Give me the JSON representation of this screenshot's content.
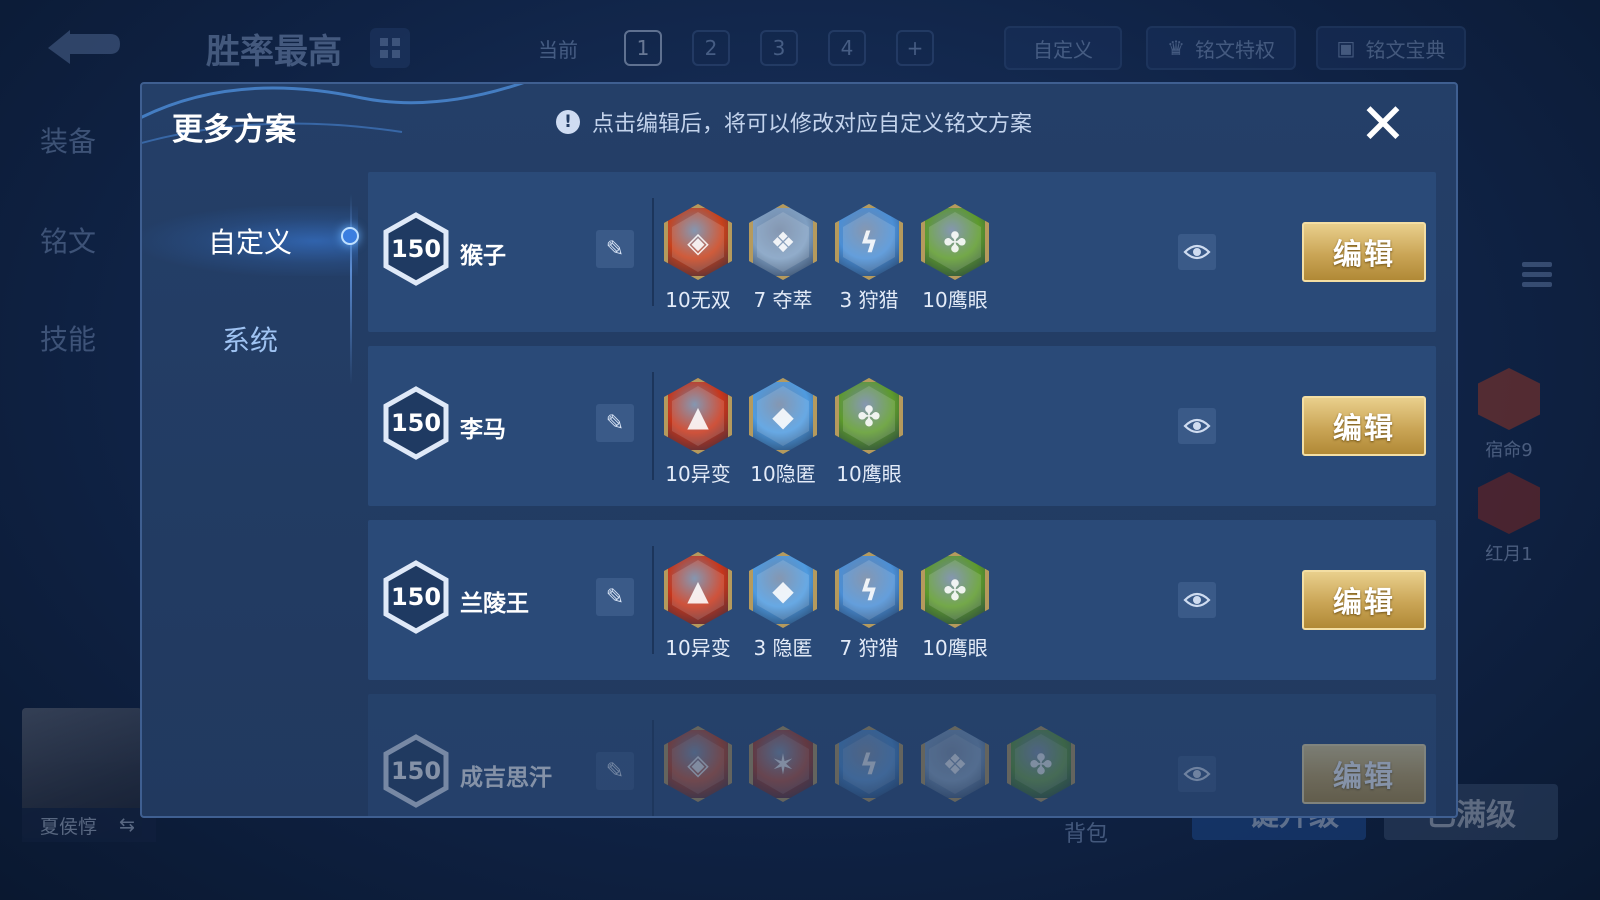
{
  "background": {
    "page_title": "胜率最高",
    "pages": {
      "current_label": "当前",
      "items": [
        "1",
        "2",
        "3",
        "4"
      ],
      "active": "1",
      "add": "+"
    },
    "custom_label": "自定义",
    "privilege_label": "铭文特权",
    "codex_label": "铭文宝典",
    "left_nav": [
      "装备",
      "铭文",
      "技能"
    ],
    "hero_name": "夏侯惇",
    "swap_glyph": "⇆",
    "bag_label": "背包",
    "upgrade_label": "一键升级",
    "maxed_label": "已满级",
    "side_runes": [
      {
        "label": "宿命9",
        "color": "#b23b1e"
      },
      {
        "label": "红月1",
        "color": "#9a2a1a"
      }
    ]
  },
  "modal": {
    "title": "更多方案",
    "notice": "点击编辑后，将可以修改对应自定义铭文方案",
    "notice_icon": "exclamation-icon",
    "close_glyph": "✕",
    "tabs": [
      {
        "label": "自定义",
        "active": true
      },
      {
        "label": "系统",
        "active": false
      }
    ],
    "edit_label": "编辑",
    "plans": [
      {
        "level": "150",
        "name": "猴子",
        "runes": [
          {
            "caption": "10无双",
            "kind": "red-fire",
            "glyph": "◈",
            "color": "#c8411b"
          },
          {
            "caption": "7 夺萃",
            "kind": "blue-knot",
            "glyph": "❖",
            "color": "#7f9fc2"
          },
          {
            "caption": "3 狩猎",
            "kind": "blue-lightning",
            "glyph": "ϟ",
            "color": "#4b8fd6"
          },
          {
            "caption": "10鹰眼",
            "kind": "green-clover",
            "glyph": "✤",
            "color": "#5d9a2c"
          }
        ]
      },
      {
        "level": "150",
        "name": "李马",
        "runes": [
          {
            "caption": "10异变",
            "kind": "red-shield",
            "glyph": "▲",
            "color": "#c7361b"
          },
          {
            "caption": "10隐匿",
            "kind": "blue-drop",
            "glyph": "◆",
            "color": "#4f9be0"
          },
          {
            "caption": "10鹰眼",
            "kind": "green-clover",
            "glyph": "✤",
            "color": "#5d9a2c"
          }
        ]
      },
      {
        "level": "150",
        "name": "兰陵王",
        "runes": [
          {
            "caption": "10异变",
            "kind": "red-shield",
            "glyph": "▲",
            "color": "#c7361b"
          },
          {
            "caption": "3 隐匿",
            "kind": "blue-drop",
            "glyph": "◆",
            "color": "#4f9be0"
          },
          {
            "caption": "7 狩猎",
            "kind": "blue-lightning",
            "glyph": "ϟ",
            "color": "#4b8fd6"
          },
          {
            "caption": "10鹰眼",
            "kind": "green-clover",
            "glyph": "✤",
            "color": "#5d9a2c"
          }
        ]
      },
      {
        "level": "150",
        "name": "成吉思汗",
        "runes": [
          {
            "caption": "",
            "kind": "red-fire",
            "glyph": "◈",
            "color": "#c8411b"
          },
          {
            "caption": "",
            "kind": "red-web",
            "glyph": "✶",
            "color": "#b3381e"
          },
          {
            "caption": "",
            "kind": "blue-lightning",
            "glyph": "ϟ",
            "color": "#4b8fd6"
          },
          {
            "caption": "",
            "kind": "blue-knot",
            "glyph": "❖",
            "color": "#7f9fc2"
          },
          {
            "caption": "",
            "kind": "green-clover",
            "glyph": "✤",
            "color": "#5d9a2c"
          }
        ]
      }
    ]
  },
  "colors": {
    "accent_gold": "#caa556",
    "panel": "#2a4a78",
    "tab_active": "#3b7ee0"
  }
}
